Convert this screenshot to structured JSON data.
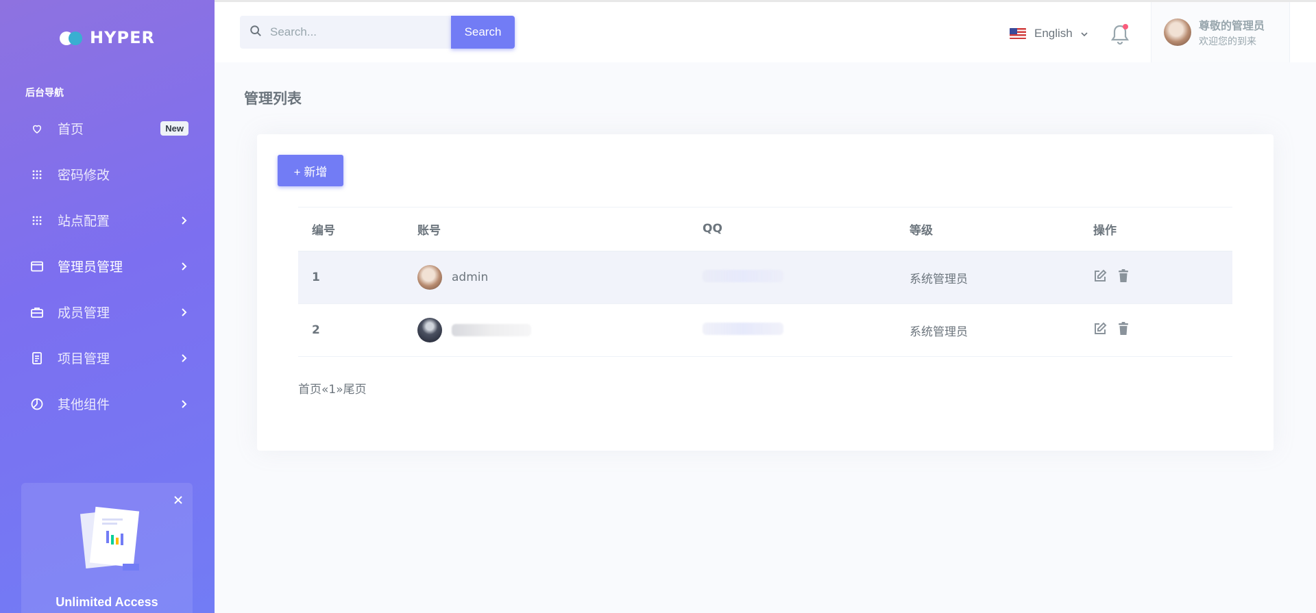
{
  "brand": {
    "name": "HYPER"
  },
  "sidebar": {
    "section_title": "后台导航",
    "items": [
      {
        "label": "首页",
        "icon": "heart-icon",
        "badge": "New"
      },
      {
        "label": "密码修改",
        "icon": "apps-grid-icon"
      },
      {
        "label": "站点配置",
        "icon": "apps-grid-icon"
      },
      {
        "label": "管理员管理",
        "icon": "browser-window-icon",
        "active": true
      },
      {
        "label": "成员管理",
        "icon": "briefcase-icon"
      },
      {
        "label": "项目管理",
        "icon": "document-icon"
      },
      {
        "label": "其他组件",
        "icon": "pie-chart-icon"
      }
    ],
    "promo": {
      "title": "Unlimited Access"
    }
  },
  "topbar": {
    "search_placeholder": "Search...",
    "search_button": "Search",
    "language": "English",
    "user": {
      "name": "尊敬的管理员",
      "subtitle": "欢迎您的到来"
    }
  },
  "page": {
    "title": "管理列表",
    "add_button": "+ 新增",
    "table": {
      "headers": [
        "编号",
        "账号",
        "QQ",
        "等级",
        "操作"
      ],
      "rows": [
        {
          "id": "1",
          "account": "admin",
          "level": "系统管理员"
        },
        {
          "id": "2",
          "account": "",
          "level": "系统管理员"
        }
      ]
    },
    "pagination": "首页«1»尾页"
  },
  "colors": {
    "primary": "#727cf5",
    "sidebar_top": "#8e72e0",
    "text": "#6c757d",
    "row_highlight": "#f1f3fa",
    "notification_dot": "#fa5c7c"
  }
}
